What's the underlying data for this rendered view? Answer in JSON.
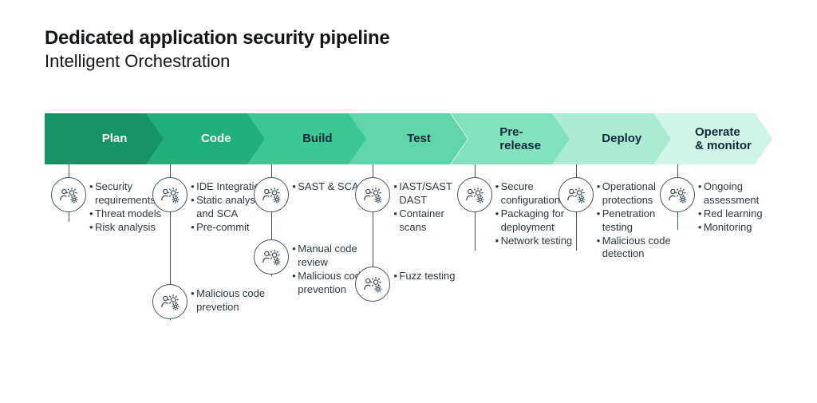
{
  "title": "Dedicated application security pipeline",
  "subtitle": "Intelligent Orchestration",
  "icon_name": "person-gear-icon",
  "stages": [
    {
      "label": "Plan",
      "color": "#149563",
      "text": "white"
    },
    {
      "label": "Code",
      "color": "#20B07A",
      "text": "white"
    },
    {
      "label": "Build",
      "color": "#3CC893",
      "text": "dark"
    },
    {
      "label": "Test",
      "color": "#5ED6A9",
      "text": "dark"
    },
    {
      "label": "Pre-\nrelease",
      "color": "#83E1BE",
      "text": "dark"
    },
    {
      "label": "Deploy",
      "color": "#AAEBD2",
      "text": "dark"
    },
    {
      "label": "Operate\n& monitor",
      "color": "#D0F4E5",
      "text": "dark"
    }
  ],
  "columns": [
    {
      "groups": [
        {
          "items": [
            "Security requirements",
            "Threat models",
            "Risk analysis"
          ]
        }
      ]
    },
    {
      "groups": [
        {
          "items": [
            "IDE Integration",
            "Static analysis and SCA",
            "Pre-commit"
          ]
        },
        {
          "items": [
            "Malicious code prevetion"
          ]
        }
      ]
    },
    {
      "groups": [
        {
          "items": [
            "SAST & SCA"
          ]
        },
        {
          "items": [
            "Manual code review",
            "Malicious code prevention"
          ]
        }
      ]
    },
    {
      "groups": [
        {
          "items": [
            "IAST/SAST DAST",
            "Container scans"
          ]
        },
        {
          "items": [
            "Fuzz testing"
          ]
        }
      ]
    },
    {
      "groups": [
        {
          "items": [
            "Secure configuration",
            "Packaging for deployment",
            "Network testing"
          ]
        }
      ]
    },
    {
      "groups": [
        {
          "items": [
            "Operational protections",
            "Penetration testing",
            "Malicious code detection"
          ]
        }
      ]
    },
    {
      "groups": [
        {
          "items": [
            "Ongoing assessment",
            "Red learning",
            "Monitoring"
          ]
        }
      ]
    }
  ]
}
